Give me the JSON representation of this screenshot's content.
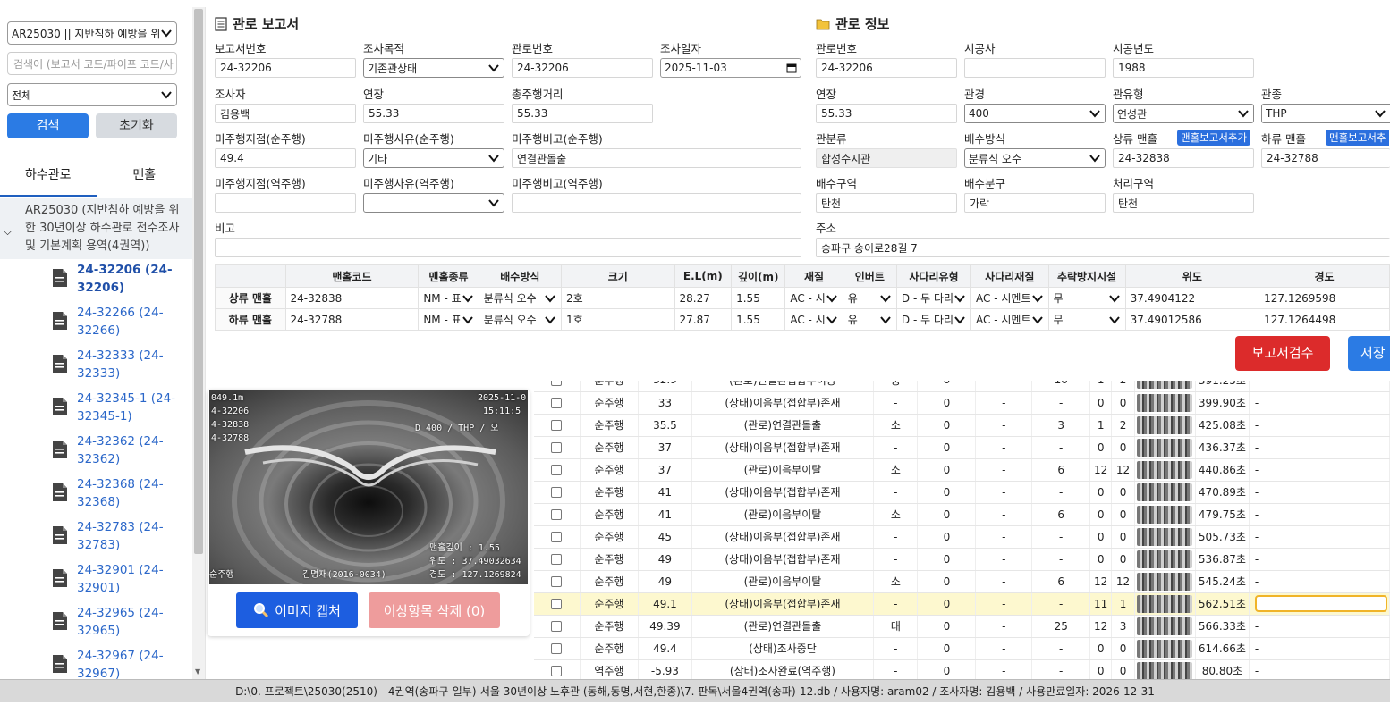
{
  "sidebar": {
    "project_select": "AR25030 || 지반침하 예방을 위한",
    "search_placeholder": "검색어 (보고서 코드/파이프 코드/사",
    "filter_select": "전체",
    "search_btn": "검색",
    "reset_btn": "초기화",
    "tabs": [
      "하수관로",
      "맨홀"
    ],
    "group_label": "AR25030 (지반침하 예방을 위한 30년이상 하수관로 전수조사 및 기본계획 용역(4권역))",
    "items": [
      "24-32206 (24-32206)",
      "24-32266 (24-32266)",
      "24-32333 (24-32333)",
      "24-32345-1 (24-32345-1)",
      "24-32362 (24-32362)",
      "24-32368 (24-32368)",
      "24-32783 (24-32783)",
      "24-32901 (24-32901)",
      "24-32965 (24-32965)",
      "24-32967 (24-32967)"
    ]
  },
  "report": {
    "title": "관로 보고서",
    "labels": {
      "report_no": "보고서번호",
      "purpose": "조사목적",
      "pipe_no": "관로번호",
      "date": "조사일자",
      "investigator": "조사자",
      "length": "연장",
      "total_dist": "총주행거리",
      "unrun_fwd": "미주행지점(순주행)",
      "unrun_reason_fwd": "미주행사유(순주행)",
      "unrun_note_fwd": "미주행비고(순주행)",
      "unrun_rev": "미주행지점(역주행)",
      "unrun_reason_rev": "미주행사유(역주행)",
      "unrun_note_rev": "미주행비고(역주행)",
      "remark": "비고"
    },
    "values": {
      "report_no": "24-32206",
      "purpose": "기존관상태",
      "pipe_no": "24-32206",
      "date": "2025-11-03",
      "investigator": "김용백",
      "length": "55.33",
      "total_dist": "55.33",
      "unrun_fwd": "49.4",
      "unrun_reason_fwd": "기타",
      "unrun_note_fwd": "연결관돌출",
      "unrun_rev": "",
      "unrun_reason_rev": "",
      "unrun_note_rev": "",
      "remark": ""
    }
  },
  "pipe_info": {
    "title": "관로 정보",
    "labels": {
      "pipe_no": "관로번호",
      "contractor": "시공사",
      "year": "시공년도",
      "length": "연장",
      "diameter": "관경",
      "pipe_type": "관유형",
      "material": "관종",
      "class": "관분류",
      "drain": "배수방식",
      "up_mh": "상류 맨홀",
      "down_mh": "하류 맨홀",
      "zone": "배수구역",
      "subzone": "배수분구",
      "treat": "처리구역",
      "address": "주소"
    },
    "values": {
      "pipe_no": "24-32206",
      "contractor": "",
      "year": "1988",
      "length": "55.33",
      "diameter": "400",
      "pipe_type": "연성관",
      "material": "THP",
      "class": "합성수지관",
      "drain": "분류식 오수",
      "up_mh": "24-32838",
      "down_mh": "24-32788",
      "zone": "탄천",
      "subzone": "가락",
      "treat": "탄천",
      "address": "송파구 송이로28길 7"
    },
    "add_up_btn": "맨홀보고서추가",
    "add_down_btn": "맨홀보고서추"
  },
  "manhole_table": {
    "headers": [
      "맨홀코드",
      "맨홀종류",
      "배수방식",
      "크기",
      "E.L(m)",
      "깊이(m)",
      "재질",
      "인버트",
      "사다리유형",
      "사다리재질",
      "추락방지시설",
      "위도",
      "경도"
    ],
    "rows": [
      {
        "label": "상류 맨홀",
        "cells": [
          "24-32838",
          "NM - 표",
          "분류식 오수",
          "2호",
          "28.27",
          "1.55",
          "AC - 시",
          "유",
          "D - 두 다리",
          "AC - 시멘트",
          "무",
          "37.4904122",
          "127.1269598"
        ]
      },
      {
        "label": "하류 맨홀",
        "cells": [
          "24-32788",
          "NM - 표",
          "분류식 오수",
          "1호",
          "27.87",
          "1.55",
          "AC - 시",
          "유",
          "D - 두 다리",
          "AC - 시멘트",
          "무",
          "37.49012586",
          "127.1264498"
        ]
      }
    ]
  },
  "actions": {
    "review_btn": "보고서검수",
    "save_btn": "저장"
  },
  "image_panel": {
    "overlay": {
      "dist": "049.1m",
      "date": "2025-11-0",
      "time": "15:11:5",
      "pipe": "4-32206",
      "up": "4-32838",
      "down": "4-32788",
      "spec": "D 400   / THP   / 오",
      "depth": "맨홀깊이 :   1.55 ",
      "lat": "위도 :  37.49032634",
      "lon": "경도 :  127.1269824",
      "dir": "순주행",
      "operator": "김명재(2016-0034)"
    },
    "capture_btn": "이미지 캡처",
    "delete_btn": "이상항목 삭제 (0)"
  },
  "observations": [
    {
      "dir": "순주행",
      "dist": "32.9",
      "desc": "(관로)연결관접합부이상",
      "grade": "중",
      "c1": "0",
      "c2": "-",
      "a": "10",
      "b": "1",
      "c": "2",
      "time": "391.25초",
      "note": "-",
      "hl": false
    },
    {
      "dir": "순주행",
      "dist": "33",
      "desc": "(상태)이음부(접합부)존재",
      "grade": "-",
      "c1": "0",
      "c2": "-",
      "a": "-",
      "b": "0",
      "c": "0",
      "time": "399.90초",
      "note": "-",
      "hl": false
    },
    {
      "dir": "순주행",
      "dist": "35.5",
      "desc": "(관로)연결관돌출",
      "grade": "소",
      "c1": "0",
      "c2": "-",
      "a": "3",
      "b": "1",
      "c": "2",
      "time": "425.08초",
      "note": "-",
      "hl": false
    },
    {
      "dir": "순주행",
      "dist": "37",
      "desc": "(상태)이음부(접합부)존재",
      "grade": "-",
      "c1": "0",
      "c2": "-",
      "a": "-",
      "b": "0",
      "c": "0",
      "time": "436.37초",
      "note": "-",
      "hl": false
    },
    {
      "dir": "순주행",
      "dist": "37",
      "desc": "(관로)이음부이탈",
      "grade": "소",
      "c1": "0",
      "c2": "-",
      "a": "6",
      "b": "12",
      "c": "12",
      "time": "440.86초",
      "note": "-",
      "hl": false
    },
    {
      "dir": "순주행",
      "dist": "41",
      "desc": "(상태)이음부(접합부)존재",
      "grade": "-",
      "c1": "0",
      "c2": "-",
      "a": "-",
      "b": "0",
      "c": "0",
      "time": "470.89초",
      "note": "-",
      "hl": false
    },
    {
      "dir": "순주행",
      "dist": "41",
      "desc": "(관로)이음부이탈",
      "grade": "소",
      "c1": "0",
      "c2": "-",
      "a": "6",
      "b": "0",
      "c": "0",
      "time": "479.75초",
      "note": "-",
      "hl": false
    },
    {
      "dir": "순주행",
      "dist": "45",
      "desc": "(상태)이음부(접합부)존재",
      "grade": "-",
      "c1": "0",
      "c2": "-",
      "a": "-",
      "b": "0",
      "c": "0",
      "time": "505.73초",
      "note": "-",
      "hl": false
    },
    {
      "dir": "순주행",
      "dist": "49",
      "desc": "(상태)이음부(접합부)존재",
      "grade": "-",
      "c1": "0",
      "c2": "-",
      "a": "-",
      "b": "0",
      "c": "0",
      "time": "536.87초",
      "note": "-",
      "hl": false
    },
    {
      "dir": "순주행",
      "dist": "49",
      "desc": "(관로)이음부이탈",
      "grade": "소",
      "c1": "0",
      "c2": "-",
      "a": "6",
      "b": "12",
      "c": "12",
      "time": "545.24초",
      "note": "-",
      "hl": false
    },
    {
      "dir": "순주행",
      "dist": "49.1",
      "desc": "(상태)이음부(접합부)존재",
      "grade": "-",
      "c1": "0",
      "c2": "-",
      "a": "-",
      "b": "11",
      "c": "1",
      "time": "562.51초",
      "note": "",
      "hl": true
    },
    {
      "dir": "순주행",
      "dist": "49.39",
      "desc": "(관로)연결관돌출",
      "grade": "대",
      "c1": "0",
      "c2": "-",
      "a": "25",
      "b": "12",
      "c": "3",
      "time": "566.33초",
      "note": "-",
      "hl": false
    },
    {
      "dir": "순주행",
      "dist": "49.4",
      "desc": "(상태)조사중단",
      "grade": "-",
      "c1": "0",
      "c2": "-",
      "a": "-",
      "b": "0",
      "c": "0",
      "time": "614.66초",
      "note": "-",
      "hl": false
    },
    {
      "dir": "역주행",
      "dist": "-5.93",
      "desc": "(상태)조사완료(역주행)",
      "grade": "-",
      "c1": "0",
      "c2": "-",
      "a": "-",
      "b": "0",
      "c": "0",
      "time": "80.80초",
      "note": "-",
      "hl": false
    }
  ],
  "status_bar": "D:\\0. 프로젝트\\25030(2510) - 4권역(송파구-일부)-서울 30년이상 노후관 (동해,동명,서현,한종)\\7. 판독\\서울4권역(송파)-12.db / 사용자명: aram02 / 조사자명: 김용백 / 사용만료일자: 2026-12-31",
  "colors": {
    "primary": "#2b7be4",
    "danger": "#dc2b2b",
    "highlight": "#fdf8cf",
    "pill": "#2b6fde"
  }
}
